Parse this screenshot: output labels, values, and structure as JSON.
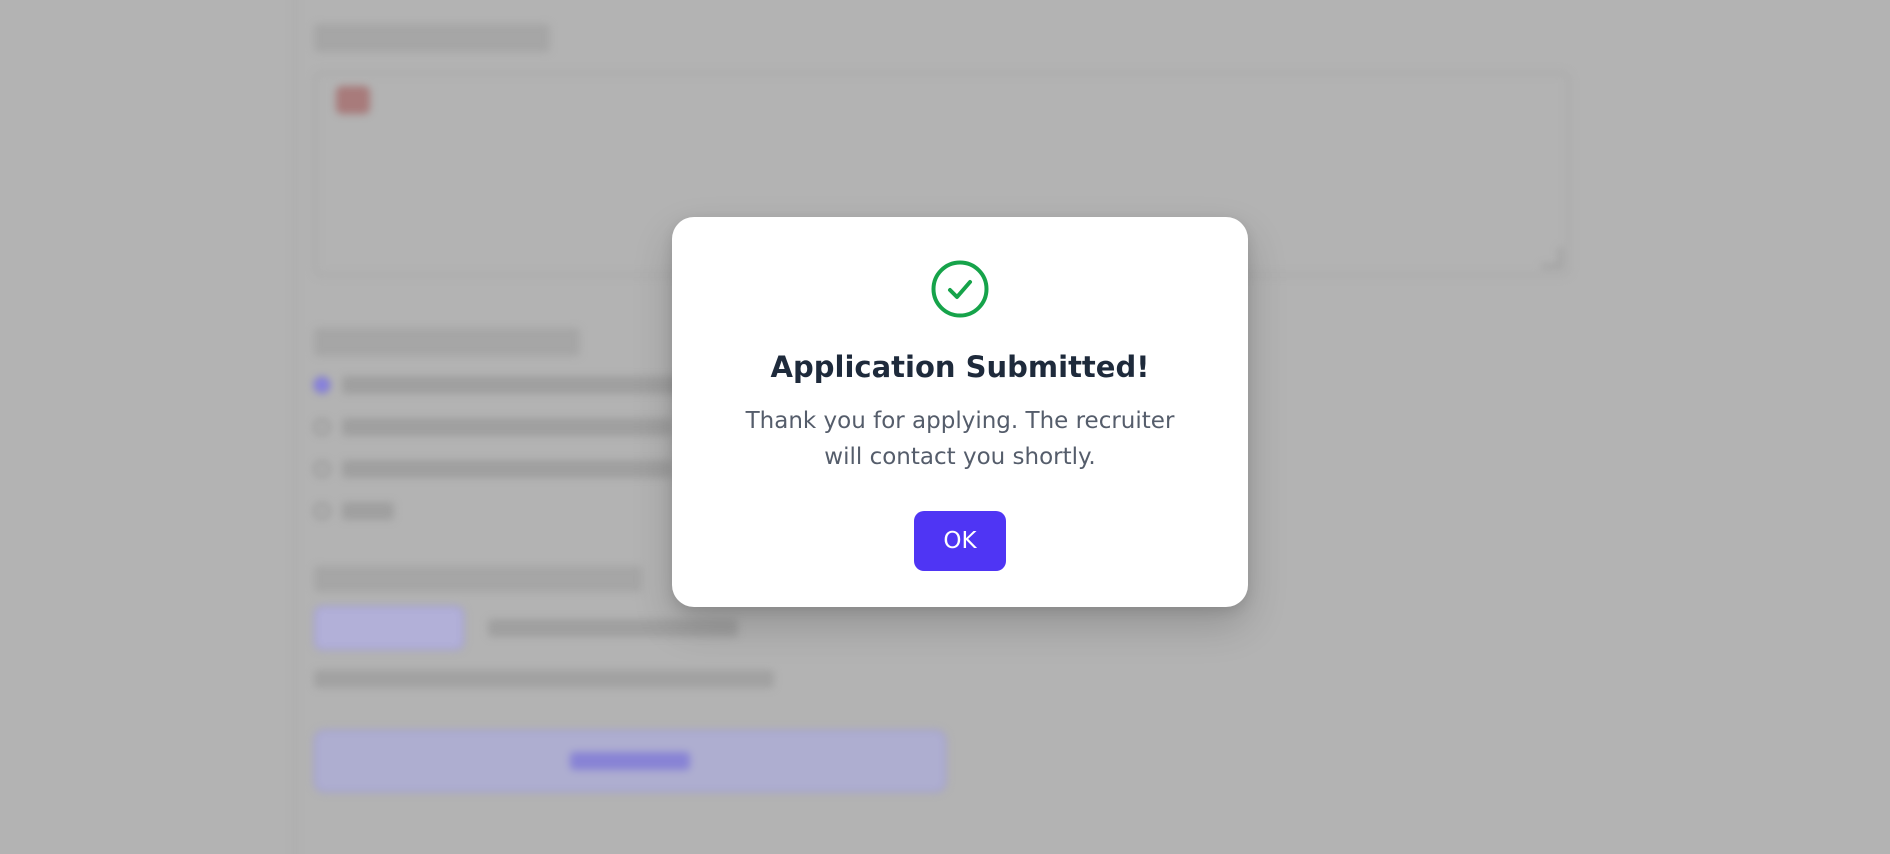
{
  "modal": {
    "title": "Application Submitted!",
    "message": "Thank you for applying. The recruiter will contact you shortly.",
    "ok_label": "OK",
    "icon": "check-circle-icon",
    "icon_color": "#16a34a",
    "button_color": "#4f35f4"
  }
}
